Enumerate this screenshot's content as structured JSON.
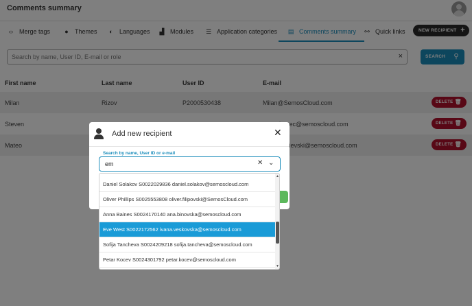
{
  "app": {
    "title": "Comments summary"
  },
  "nav": {
    "items": [
      {
        "label": "Merge tags",
        "icon": "chevrons-left-right-icon"
      },
      {
        "label": "Themes",
        "icon": "palette-icon"
      },
      {
        "label": "Languages",
        "icon": "globe-icon"
      },
      {
        "label": "Modules",
        "icon": "sitemap-icon"
      },
      {
        "label": "Application categories",
        "icon": "list-icon"
      },
      {
        "label": "Comments summary",
        "icon": "book-icon",
        "active": true
      },
      {
        "label": "Quick links",
        "icon": "link-icon"
      }
    ],
    "new_recipient_label": "NEW RECIPIENT"
  },
  "search": {
    "placeholder": "Search by name, User ID, E-mail or role",
    "button_label": "SEARCH"
  },
  "table": {
    "columns": [
      "First name",
      "Last name",
      "User ID",
      "E-mail"
    ],
    "rows": [
      {
        "first": "Milan",
        "last": "Rizov",
        "user_id": "P2000530438",
        "email": "Milan@SemosCloud.com"
      },
      {
        "first": "Steven",
        "last": "",
        "user_id": "",
        "email": "kupec@semoscloud.com"
      },
      {
        "first": "Mateo",
        "last": "",
        "user_id": "",
        "email": "nasievski@semoscloud.com"
      }
    ],
    "delete_label": "DELETE"
  },
  "modal": {
    "title": "Add new recipient",
    "field_label": "Search by name, User ID or e-mail",
    "field_value": "em",
    "options": [
      "Daniel Solakov S0022029836 daniel.solakov@semoscloud.com",
      "Oliver Phillips S0025553808 oliver.filipovski@SemosCloud.com",
      "Anna Baines S0024170140 ana.binovska@semoscloud.com",
      "Eve West S0022172562 ivana.veskovska@semoscloud.com",
      "Sofija Tancheva S0024209218 sofija.tancheva@semoscloud.com",
      "Petar Kocev S0024301792 petar.kocev@semoscloud.com"
    ],
    "highlighted_index": 3
  },
  "colors": {
    "accent": "#1b8dbb",
    "highlight": "#1a9bd7",
    "delete": "#b1112d",
    "dark_button": "#2b2b2b",
    "confirm": "#5cb85c"
  }
}
